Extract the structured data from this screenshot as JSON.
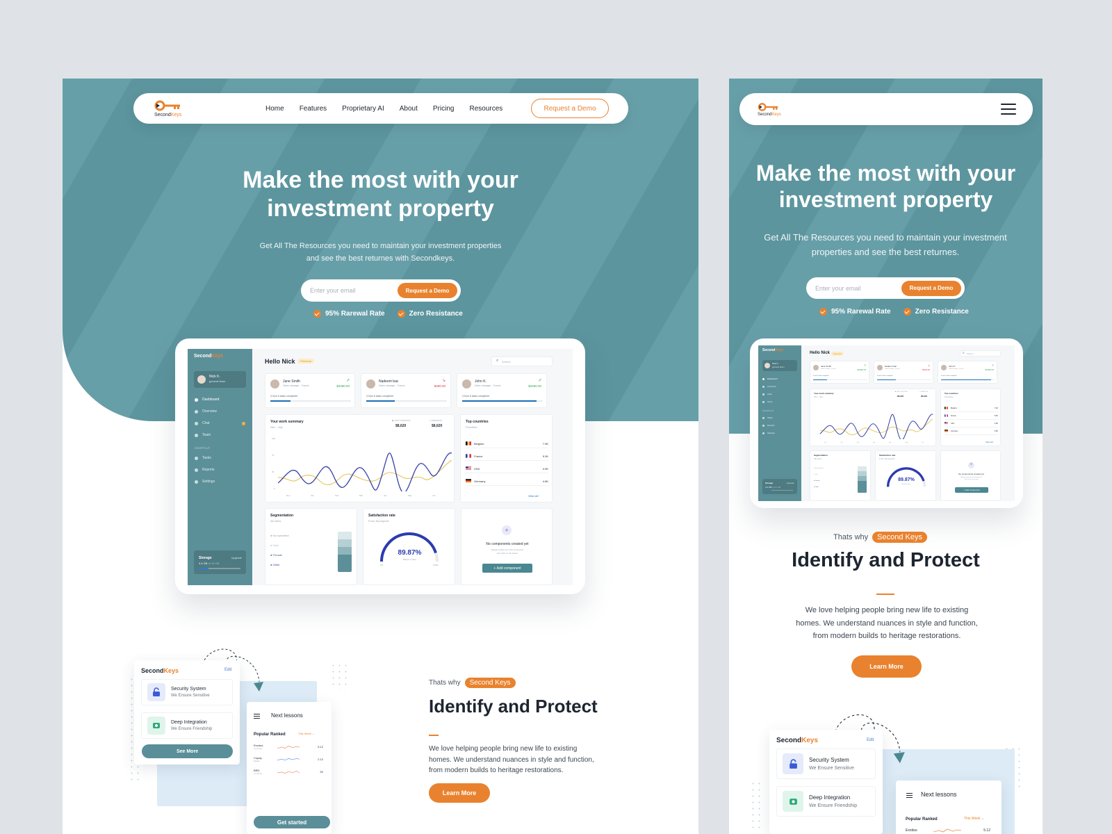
{
  "brand": {
    "name_a": "Second",
    "name_b": "Keys",
    "accent": "#e9822e",
    "teal": "#5f9aa4"
  },
  "nav": {
    "items": [
      "Home",
      "Features",
      "Proprietary AI",
      "About",
      "Pricing",
      "Resources"
    ],
    "cta": "Request a Demo"
  },
  "hero": {
    "title_line1": "Make the most with your",
    "title_line2": "investment property",
    "subtitle_desktop_1": "Get All The Resources you need to maintain your investment properties",
    "subtitle_desktop_2": "and see the best returnes with Secondkeys.",
    "subtitle_mobile_1": "Get All The Resources you need to maintain your investment",
    "subtitle_mobile_2": "properties and see the best returnes.",
    "email_placeholder": "Enter your email",
    "email_button": "Request a Demo",
    "check_1": "95% Rarewal Rate",
    "check_2": "Zero Resistance"
  },
  "dashboard": {
    "greeting": "Hello Nick",
    "badge": "Premium",
    "search": "Search",
    "user_name": "Nick K.",
    "user_role": "general team",
    "sidebar": [
      "Dashboard",
      "Overview",
      "Chat",
      "Team"
    ],
    "shortcut_label": "SHORTCUT",
    "shortcuts": [
      "Tasks",
      "Reports",
      "Settings"
    ],
    "storage_label": "Storage",
    "storage_upgrade": "Upgrade",
    "storage_value": "3.4 GB",
    "storage_total": "of 15 GB",
    "people": [
      {
        "name": "Jane Smith",
        "role": "Sales manager - France",
        "amount": "$3490.00",
        "tasks": "3 from 6 tasks completed",
        "trend": "up"
      },
      {
        "name": "Nadeem bac",
        "role": "Sales manager - France",
        "amount": "$490.00",
        "tasks": "3 from 6 tasks completed",
        "trend": "down"
      },
      {
        "name": "John K.",
        "role": "Sales manager - France",
        "amount": "$3490.00",
        "tasks": "3 from 6 tasks completed",
        "trend": "up"
      }
    ],
    "work_summary": {
      "title": "Your work summary",
      "sub": "Nov - July",
      "legend_1": "LAST 6 MONTHS",
      "legend_2": "PREVIOUS",
      "value_1": "$8,620",
      "value_2": "$8,620",
      "y_ticks": [
        "100",
        "75",
        "25",
        "0"
      ],
      "x_ticks": [
        "Dec",
        "Jan",
        "Feb",
        "Mar",
        "Apr",
        "May",
        "Jun"
      ]
    },
    "top_countries": {
      "title": "Top countries",
      "sub": "Favorites",
      "rows": [
        {
          "name": "Belgium",
          "value": "7.9K"
        },
        {
          "name": "France",
          "value": "5.3K"
        },
        {
          "name": "USA",
          "value": "4.9K"
        },
        {
          "name": "Germany",
          "value": "4.8K"
        }
      ],
      "view_all": "View all"
    },
    "segmentation": {
      "title": "Segmentation",
      "sub": "All users",
      "items": [
        "Not specified",
        "Male",
        "Female",
        "Other"
      ]
    },
    "satisfaction": {
      "title": "Satisfaction rate",
      "sub": "From all projects",
      "value": "89.87%",
      "caption": "Based on likes",
      "min": "0%",
      "max": "100%",
      "fraction": 0.8987
    },
    "empty": {
      "title": "No components created yet",
      "text_1": "Simply create your first component",
      "text_2": "Just click on the button",
      "button": "Add component"
    }
  },
  "identify": {
    "why": "Thats why",
    "tag": "Second Keys",
    "title": "Identify and Protect",
    "text_desktop_1": "We love helping people bring new life to existing",
    "text_desktop_2": "homes. We understand nuances in style and function,",
    "text_desktop_3": "from modern builds to heritage restorations.",
    "text_mobile_1": "We love helping people bring new life to existing",
    "text_mobile_2": "homes. We understand nuances in style and function,",
    "text_mobile_3": "from modern builds to heritage restorations.",
    "button": "Learn More"
  },
  "features": {
    "edit": "Edit",
    "items": [
      {
        "title": "Security System",
        "sub": "We Ensure Sensitive"
      },
      {
        "title": "Deep Integration",
        "sub": "We Ensure Friendship"
      }
    ],
    "see_more": "See More",
    "lessons_title": "Next lessons",
    "popular": "Popular Ranked",
    "this_week": "This Week",
    "lessons": [
      {
        "name": "Exodus",
        "sub": "Common",
        "value": "5.12"
      },
      {
        "name": "Copay",
        "sub": "Mobile",
        "value": "2.12"
      },
      {
        "name": "BRD",
        "sub": "Common",
        "value": "52"
      }
    ],
    "get_started": "Get started"
  }
}
